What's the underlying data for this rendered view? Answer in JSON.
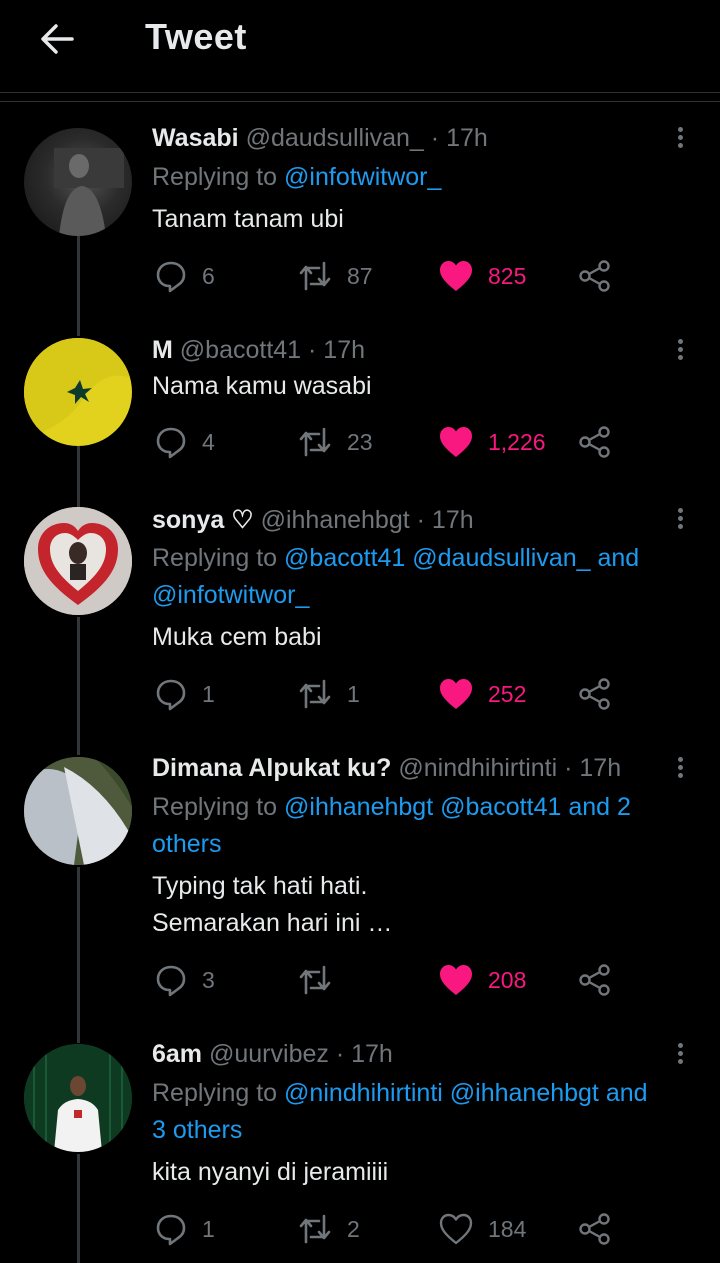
{
  "header": {
    "title": "Tweet"
  },
  "colors": {
    "accent": "#1d9bf0",
    "like": "#f91880",
    "muted": "#71767b"
  },
  "tweets": [
    {
      "name": "Wasabi",
      "handle": "@daudsullivan_",
      "time": "· 17h",
      "reply_prefix": "Replying to",
      "mentions": "@infotwitwor_",
      "text": "Tanam tanam ubi",
      "replies": "6",
      "retweets": "87",
      "likes": "825",
      "liked": true
    },
    {
      "name": "M",
      "handle": "@bacott41",
      "time": "· 17h",
      "text": "Nama kamu wasabi",
      "replies": "4",
      "retweets": "23",
      "likes": "1,226",
      "liked": true
    },
    {
      "name": "sonya ♡",
      "handle": "@ihhanehbgt",
      "time": "· 17h",
      "reply_prefix": "Replying to",
      "mentions_line1": "@bacott41 @daudsullivan_ and",
      "mentions_line2": "@infotwitwor_",
      "text": "Muka cem babi",
      "replies": "1",
      "retweets": "1",
      "likes": "252",
      "liked": true
    },
    {
      "name": "Dimana Alpukat ku?",
      "handle": "@nindhihirtinti",
      "time": "· 17h",
      "reply_prefix": "Replying to",
      "mentions_line1": "@ihhanehbgt @bacott41 and 2",
      "mentions_line2": "others",
      "text_line1": "Typing tak hati hati.",
      "text_line2": "Semarakan hari ini …",
      "replies": "3",
      "retweets": "",
      "likes": "208",
      "liked": true
    },
    {
      "name": "6am",
      "handle": "@uurvibez",
      "time": "· 17h",
      "reply_prefix": "Replying to",
      "mentions_line1": "@nindhihirtinti @ihhanehbgt and",
      "mentions_line2": "3 others",
      "text": "kita nyanyi di jeramiiii",
      "replies": "1",
      "retweets": "2",
      "likes": "184",
      "liked": false
    }
  ]
}
